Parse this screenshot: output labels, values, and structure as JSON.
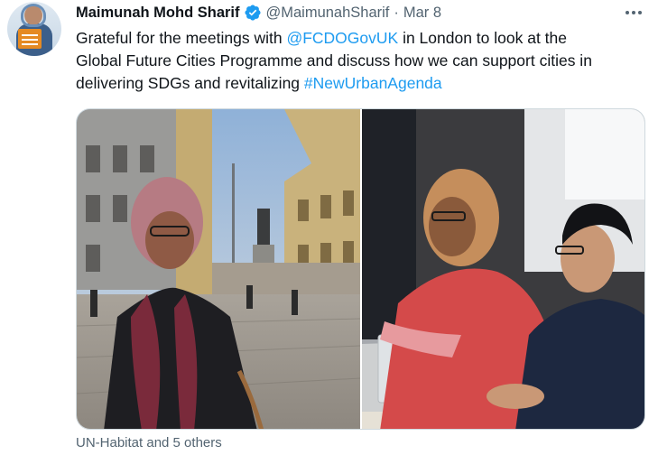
{
  "tweet": {
    "author_name": "Maimunah Mohd Sharif",
    "handle": "@MaimunahSharif",
    "separator": "·",
    "date": "Mar 8",
    "text": {
      "line1_pre": "Grateful for the meetings with ",
      "mention": "@FCDOGovUK",
      "line1_post": " in London to look at the",
      "line2": "Global Future Cities Programme and discuss how we can support cities in",
      "line3_pre": "delivering SDGs and revitalizing ",
      "hashtag": "#NewUrbanAgenda"
    },
    "tagged_people": "UN-Habitat and 5 others"
  },
  "icons": {
    "verified": "verified-badge-icon",
    "more": "more-options-icon"
  },
  "colors": {
    "link": "#1d9bf0",
    "secondary_text": "#536471",
    "verified": "#1d9bf0",
    "border": "#cfd9de"
  }
}
